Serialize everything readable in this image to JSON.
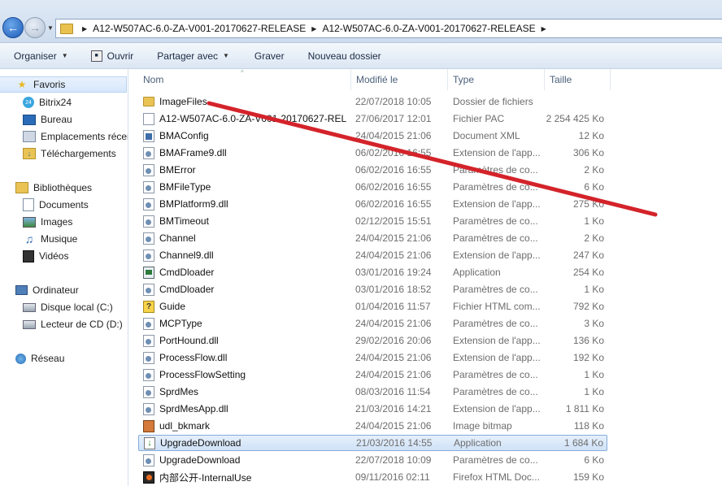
{
  "address": {
    "crumbs": [
      "A12-W507AC-6.0-ZA-V001-20170627-RELEASE",
      "A12-W507AC-6.0-ZA-V001-20170627-RELEASE"
    ]
  },
  "toolbar": {
    "organiser": "Organiser",
    "ouvrir": "Ouvrir",
    "partager": "Partager avec",
    "graver": "Graver",
    "nouveau": "Nouveau dossier"
  },
  "nav": {
    "favoris": "Favoris",
    "bitrix": "Bitrix24",
    "bureau": "Bureau",
    "emplacements": "Emplacements récents",
    "telechargements": "Téléchargements",
    "bibliotheques": "Bibliothèques",
    "documents": "Documents",
    "images": "Images",
    "musique": "Musique",
    "videos": "Vidéos",
    "ordinateur": "Ordinateur",
    "disque": "Disque local (C:)",
    "lecteur": "Lecteur de CD (D:)",
    "reseau": "Réseau"
  },
  "columns": {
    "name": "Nom",
    "date": "Modifié le",
    "type": "Type",
    "size": "Taille"
  },
  "files": [
    {
      "name": "ImageFiles",
      "date": "22/07/2018 10:05",
      "type": "Dossier de fichiers",
      "size": "",
      "icon": "folder-icon"
    },
    {
      "name": "A12-W507AC-6.0-ZA-V001-20170627-REL...",
      "date": "27/06/2017 12:01",
      "type": "Fichier PAC",
      "size": "2 254 425 Ko",
      "icon": "document-icon"
    },
    {
      "name": "BMAConfig",
      "date": "24/04/2015 21:06",
      "type": "Document XML",
      "size": "12 Ko",
      "icon": "xml-document-icon"
    },
    {
      "name": "BMAFrame9.dll",
      "date": "06/02/2016 16:55",
      "type": "Extension de l'app...",
      "size": "306 Ko",
      "icon": "dll-icon"
    },
    {
      "name": "BMError",
      "date": "06/02/2016 16:55",
      "type": "Paramètres de co...",
      "size": "2 Ko",
      "icon": "settings-file-icon"
    },
    {
      "name": "BMFileType",
      "date": "06/02/2016 16:55",
      "type": "Paramètres de co...",
      "size": "6 Ko",
      "icon": "settings-file-icon"
    },
    {
      "name": "BMPlatform9.dll",
      "date": "06/02/2016 16:55",
      "type": "Extension de l'app...",
      "size": "275 Ko",
      "icon": "dll-icon"
    },
    {
      "name": "BMTimeout",
      "date": "02/12/2015 15:51",
      "type": "Paramètres de co...",
      "size": "1 Ko",
      "icon": "settings-file-icon"
    },
    {
      "name": "Channel",
      "date": "24/04/2015 21:06",
      "type": "Paramètres de co...",
      "size": "2 Ko",
      "icon": "settings-file-icon"
    },
    {
      "name": "Channel9.dll",
      "date": "24/04/2015 21:06",
      "type": "Extension de l'app...",
      "size": "247 Ko",
      "icon": "dll-icon"
    },
    {
      "name": "CmdDloader",
      "date": "03/01/2016 19:24",
      "type": "Application",
      "size": "254 Ko",
      "icon": "application-icon"
    },
    {
      "name": "CmdDloader",
      "date": "03/01/2016 18:52",
      "type": "Paramètres de co...",
      "size": "1 Ko",
      "icon": "settings-file-icon"
    },
    {
      "name": "Guide",
      "date": "01/04/2016 11:57",
      "type": "Fichier HTML com...",
      "size": "792 Ko",
      "icon": "help-file-icon"
    },
    {
      "name": "MCPType",
      "date": "24/04/2015 21:06",
      "type": "Paramètres de co...",
      "size": "3 Ko",
      "icon": "settings-file-icon"
    },
    {
      "name": "PortHound.dll",
      "date": "29/02/2016 20:06",
      "type": "Extension de l'app...",
      "size": "136 Ko",
      "icon": "dll-icon"
    },
    {
      "name": "ProcessFlow.dll",
      "date": "24/04/2015 21:06",
      "type": "Extension de l'app...",
      "size": "192 Ko",
      "icon": "dll-icon"
    },
    {
      "name": "ProcessFlowSetting",
      "date": "24/04/2015 21:06",
      "type": "Paramètres de co...",
      "size": "1 Ko",
      "icon": "settings-file-icon"
    },
    {
      "name": "SprdMes",
      "date": "08/03/2016 11:54",
      "type": "Paramètres de co...",
      "size": "1 Ko",
      "icon": "settings-file-icon"
    },
    {
      "name": "SprdMesApp.dll",
      "date": "21/03/2016 14:21",
      "type": "Extension de l'app...",
      "size": "1 811 Ko",
      "icon": "dll-icon"
    },
    {
      "name": "udl_bkmark",
      "date": "24/04/2015 21:06",
      "type": "Image bitmap",
      "size": "118 Ko",
      "icon": "bitmap-icon"
    },
    {
      "name": "UpgradeDownload",
      "date": "21/03/2016 14:55",
      "type": "Application",
      "size": "1 684 Ko",
      "icon": "download-app-icon",
      "selected": true
    },
    {
      "name": "UpgradeDownload",
      "date": "22/07/2018 10:09",
      "type": "Paramètres de co...",
      "size": "6 Ko",
      "icon": "settings-file-icon"
    },
    {
      "name": "内部公开-InternalUse",
      "date": "09/11/2016 02:11",
      "type": "Firefox HTML Doc...",
      "size": "159 Ko",
      "icon": "firefox-document-icon"
    }
  ],
  "annotation_color": "#d4232a"
}
